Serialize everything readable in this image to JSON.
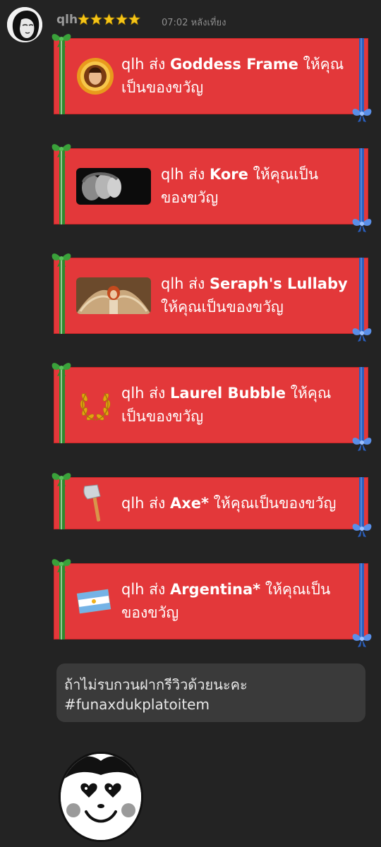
{
  "header": {
    "username": "qlh",
    "star_count": 5,
    "time": "07:02 หลังเที่ยง",
    "star_color": "#f5c518"
  },
  "gifts": [
    {
      "sender": "qlh",
      "verb": "ส่ง",
      "item": "Goddess Frame",
      "line1_suffix": "ให้คุณ",
      "line2": "เป็นของขวัญ",
      "thumb": "goddess-frame-icon"
    },
    {
      "sender": "qlh",
      "verb": "ส่ง",
      "item": "Kore",
      "line1_suffix": "ให้คุณเป็น",
      "line2": "ของขวัญ",
      "thumb": "kore-statue-image"
    },
    {
      "sender": "qlh",
      "verb": "ส่ง",
      "item": "Seraph's Lullaby",
      "line1_suffix": "",
      "line2": "ให้คุณเป็นของขวัญ",
      "thumb": "seraph-painting-image"
    },
    {
      "sender": "qlh",
      "verb": "ส่ง",
      "item": "Laurel Bubble",
      "line1_suffix": "ให้คุณ",
      "line2": "เป็นของขวัญ",
      "thumb": "laurel-wreath-icon"
    },
    {
      "sender": "qlh",
      "verb": "ส่ง",
      "item": "Axe*",
      "line1_suffix": "ให้คุณเป็นของขวัญ",
      "line2": "",
      "thumb": "axe-icon"
    },
    {
      "sender": "qlh",
      "verb": "ส่ง",
      "item": "Argentina*",
      "line1_suffix": "ให้คุณเป็น",
      "line2": "ของขวัญ",
      "thumb": "argentina-flag-icon"
    }
  ],
  "comment": {
    "line1": "ถ้าไม่รบกวนฝากรีวิวด้วยนะคะ",
    "line2": "#funaxdukplatoitem"
  },
  "colors": {
    "background": "#232323",
    "gift_red": "#e3383a",
    "ribbon_green": "#2e8b2e",
    "ribbon_blue": "#2a5fbf",
    "comment_bg": "#3a3a3a"
  }
}
